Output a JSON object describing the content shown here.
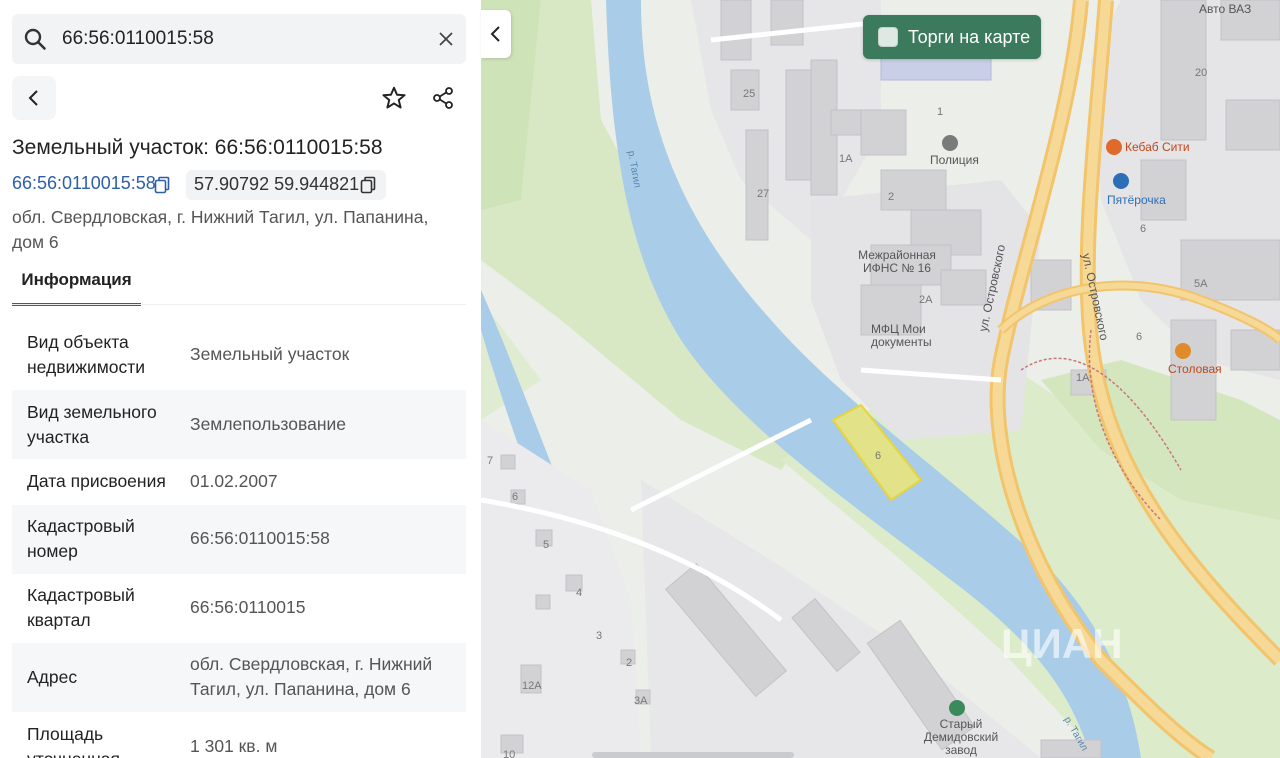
{
  "search": {
    "value": "66:56:0110015:58"
  },
  "object": {
    "title": "Земельный участок: 66:56:0110015:58",
    "cadastral_link": "66:56:0110015:58",
    "coords": "57.90792 59.944821",
    "address": "обл. Свердловская, г. Нижний Тагил, ул. Папанина, дом 6"
  },
  "tabs": [
    {
      "label": "Информация"
    }
  ],
  "properties": [
    {
      "key": "Вид объекта недвижимости",
      "value": "Земельный участок"
    },
    {
      "key": "Вид земельного участка",
      "value": "Землепользование"
    },
    {
      "key": "Дата присвоения",
      "value": "01.02.2007"
    },
    {
      "key": "Кадастровый номер",
      "value": "66:56:0110015:58"
    },
    {
      "key": "Кадастровый квартал",
      "value": "66:56:0110015"
    },
    {
      "key": "Адрес",
      "value": "обл. Свердловская, г. Нижний Тагил, ул. Папанина, дом 6"
    },
    {
      "key": "Площадь уточненная",
      "value": "1 301 кв. м"
    }
  ],
  "map": {
    "auction_toggle": "Торги на карте",
    "labels": {
      "police": "Полиция",
      "ifns": "Межрайонная ИФНС № 16",
      "mfc": "МФЦ Мои документы",
      "kebab": "Кебаб Сити",
      "pyaterochka": "Пятёрочка",
      "stolovaya": "Столовая",
      "avto_vaz": "Авто ВАЗ",
      "ostrovskogo_1": "ул. Островского",
      "ostrovskogo_2": "ул. Островского",
      "tagil_river_1": "р. Тагил",
      "tagil_river_2": "р. Тагил",
      "staryi_zavod": "Старый Демидовский завод",
      "watermark": "ЦИАН"
    },
    "house_numbers": [
      "25",
      "1",
      "1А",
      "27",
      "2",
      "2А",
      "1А",
      "6",
      "20",
      "5А",
      "6",
      "7",
      "6",
      "5",
      "4",
      "3",
      "2",
      "3А",
      "12А",
      "10",
      "6"
    ],
    "colors": {
      "road": "#f2c46b",
      "river": "#a9cde8",
      "park": "#d7e9c4",
      "parcel": "#f5e86a",
      "building": "#d3d3d6",
      "accent": "#2d5fa8",
      "toggle_bg": "#3b7a5c"
    }
  }
}
